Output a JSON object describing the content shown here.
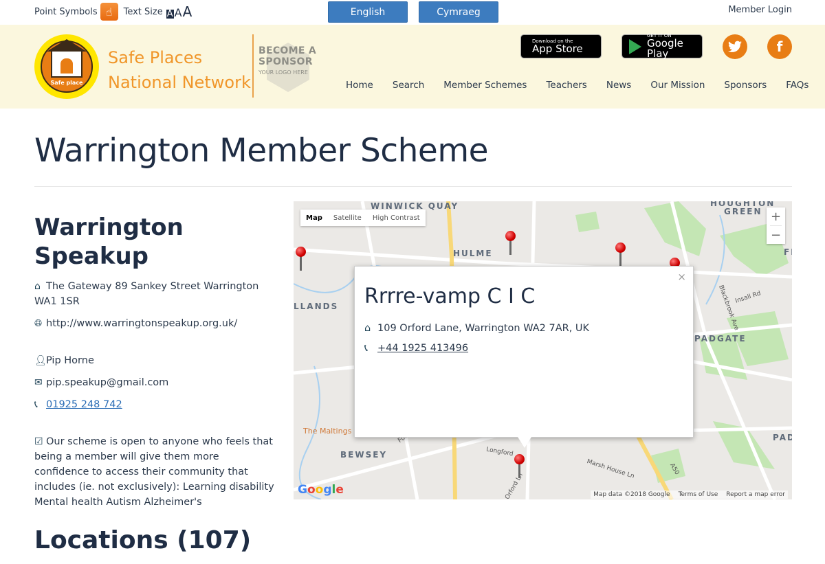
{
  "topbar": {
    "point_symbols_label": "Point Symbols",
    "text_size_label": "Text Size",
    "text_size_options": [
      "A",
      "A",
      "A"
    ],
    "languages": [
      "English",
      "Cymraeg"
    ],
    "member_login": "Member Login"
  },
  "header": {
    "logo_label": "Safe place",
    "brand_line1": "Safe Places",
    "brand_line2": "National Network",
    "sponsor_line1": "BECOME A",
    "sponsor_line2": "SPONSOR",
    "sponsor_line3": "YOUR LOGO HERE",
    "app_store_small": "Download on the",
    "app_store_big": "App Store",
    "google_play_small": "GET IT ON",
    "google_play_big": "Google Play",
    "nav": [
      "Home",
      "Search",
      "Member Schemes",
      "Teachers",
      "News",
      "Our Mission",
      "Sponsors",
      "FAQs"
    ]
  },
  "page": {
    "title": "Warrington Member Scheme",
    "org_name": "Warrington Speakup",
    "address": "The Gateway 89 Sankey Street Warrington WA1 1SR",
    "website": "http://www.warringtonspeakup.org.uk/",
    "contact_name": "Pip Horne",
    "email": "pip.speakup@gmail.com",
    "phone": "01925 248 742",
    "description": "Our scheme is open to anyone who feels that being a member will give them more confidence to access their community that includes (ie. not exclusively): Learning disability Mental health Autism Alzheimer's",
    "locations_heading": "Locations (107)"
  },
  "map": {
    "type_controls": [
      "Map",
      "Satellite",
      "High Contrast"
    ],
    "active_type": "Map",
    "zoom_in": "+",
    "zoom_out": "−",
    "area_labels": [
      "WINWICK QUAY",
      "HULME",
      "HOUGHTON",
      "GREEN",
      "LLANDS",
      "PADGATE",
      "BEWSEY",
      "PADD",
      "FI"
    ],
    "road_labels": [
      "Insall Rd",
      "Blackbrook Ave",
      "Folly Ln",
      "Longford",
      "Marsh House Ln",
      "A50",
      "Orford Ln",
      "The Maltings"
    ],
    "info_window": {
      "title": "Rrrre-vamp C I C",
      "address": "109 Orford Lane, Warrington WA2 7AR, UK",
      "phone": "+44 1925 413496",
      "close": "×"
    },
    "google_logo": "Google",
    "footer": [
      "Map data ©2018 Google",
      "Terms of Use",
      "Report a map error"
    ],
    "colors": {
      "pin": "#d00000",
      "park": "#c0e8b0",
      "water": "#a8d0f0",
      "major_road": "#f8d878"
    }
  }
}
